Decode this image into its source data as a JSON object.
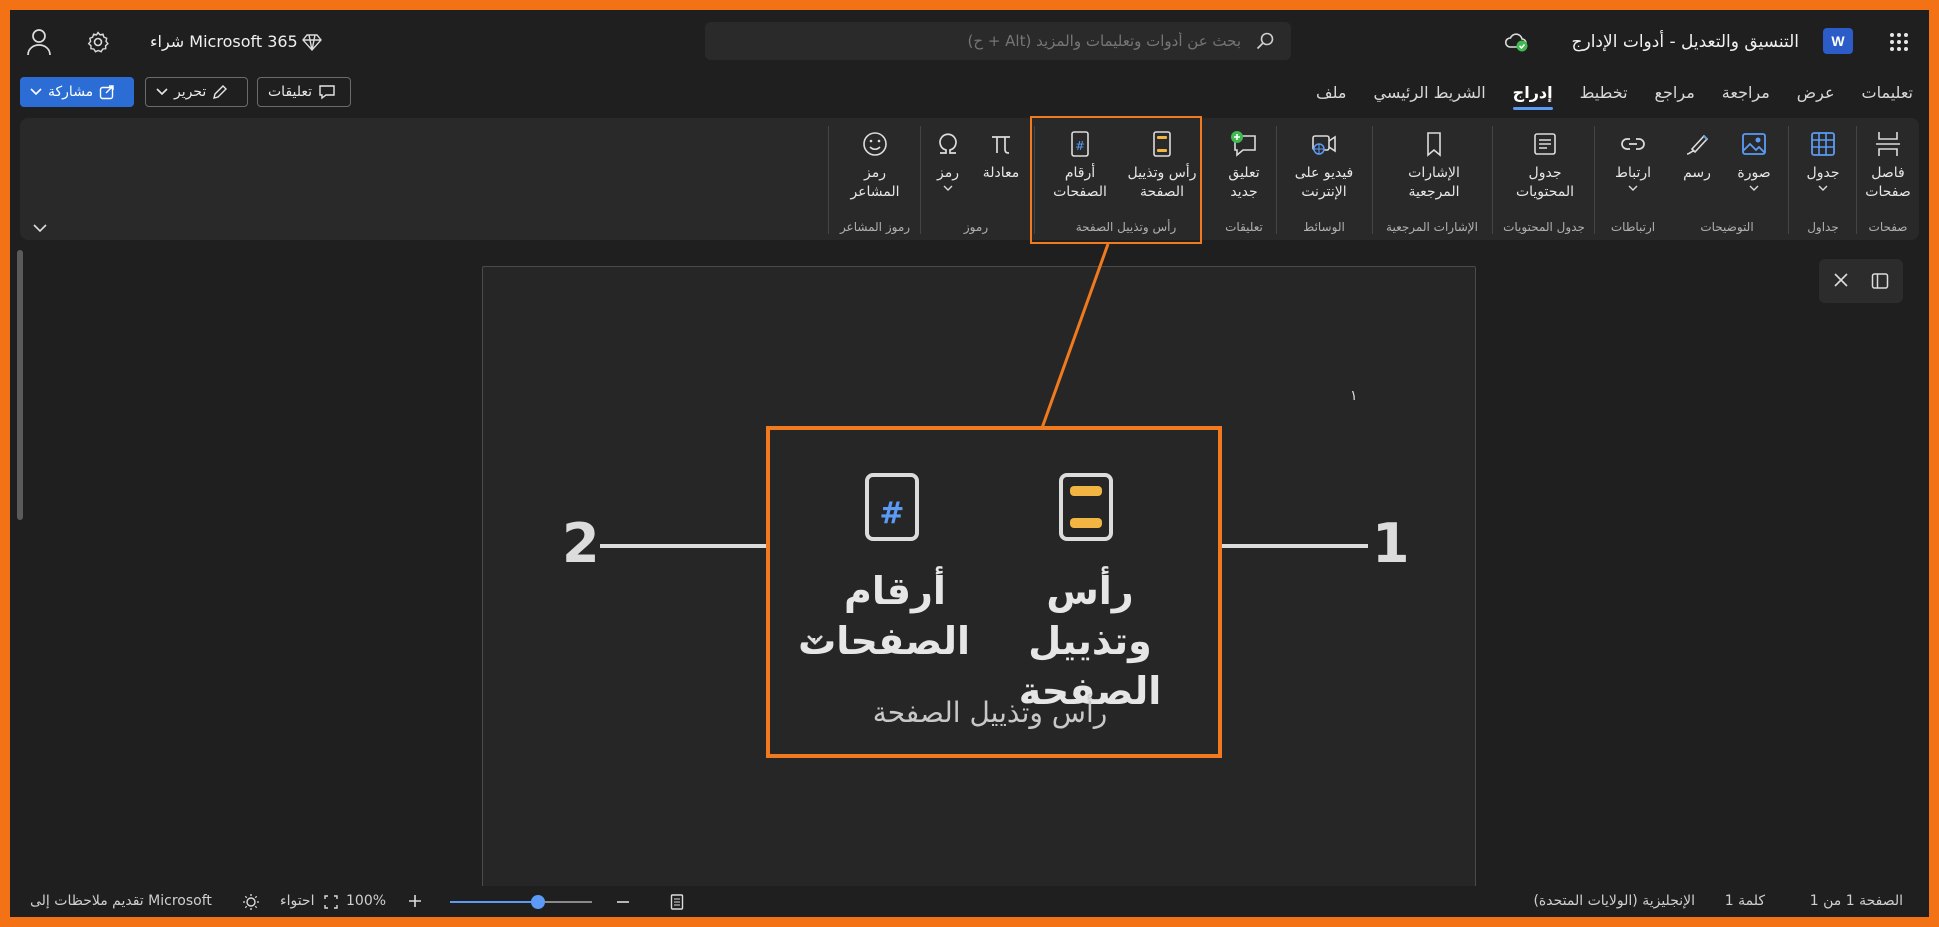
{
  "app": {
    "doc_title": "التنسيق والتعديل - أدوات الإدارج",
    "word_logo": "W",
    "buy_label": "شراء Microsoft 365"
  },
  "search": {
    "placeholder": "بحث عن أدوات وتعليمات والمزيد (Alt + ح)"
  },
  "menu": {
    "tabs": [
      "ملف",
      "الشريط الرئيسي",
      "إدراج",
      "تخطيط",
      "مراجع",
      "مراجعة",
      "عرض",
      "تعليمات"
    ],
    "active_tab": "إدراج"
  },
  "actions": {
    "share": "مشاركة",
    "edit": "تحرير",
    "comments": "تعليقات"
  },
  "ribbon": {
    "groups": {
      "pages": "صفحات",
      "tables": "جداول",
      "illustrations": "التوضيحات",
      "links": "ارتباطات",
      "toc": "جدول المحتويات",
      "bookmarks": "الإشارات المرجعية",
      "media": "الوسائط",
      "comments": "تعليقات",
      "header_footer": "رأس وتذييل الصفحة",
      "symbols": "رموز",
      "emoji": "رموز المشاعر"
    },
    "items": {
      "page_break": "فاصل\nصفحات",
      "table": "جدول",
      "picture": "صورة",
      "draw": "رسم",
      "link": "ارتباط",
      "toc": "جدول\nالمحتويات",
      "bookmarks": "الإشارات\nالمرجعية",
      "online_video": "فيديو على\nالإنترنت",
      "new_comment": "تعليق\nجديد",
      "header_footer": "رأس وتذييل\nالصفحة",
      "page_numbers": "أرقام\nالصفحات",
      "equation": "معادلة",
      "symbol": "رمز",
      "emoji": "رمز\nالمشاعر"
    }
  },
  "document": {
    "page_number_text": "١"
  },
  "callout": {
    "header_footer": "رأس وتذييل\nالصفحة",
    "page_numbers": "أرقام\nالصفحات",
    "group_label": "رأس وتذييل الصفحة",
    "num1": "1",
    "num2": "2"
  },
  "status": {
    "page": "الصفحة 1 من 1",
    "words": "كلمة 1",
    "language": "الإنجليزية (الولايات المتحدة)",
    "zoom": "100%",
    "fit": "احتواء",
    "feedback": "تقديم ملاحظات إلى Microsoft",
    "zoom_level": 0.62
  },
  "colors": {
    "accent": "#5b9bf5",
    "highlight": "#f07a1d",
    "header_icon": "#f2b544"
  }
}
